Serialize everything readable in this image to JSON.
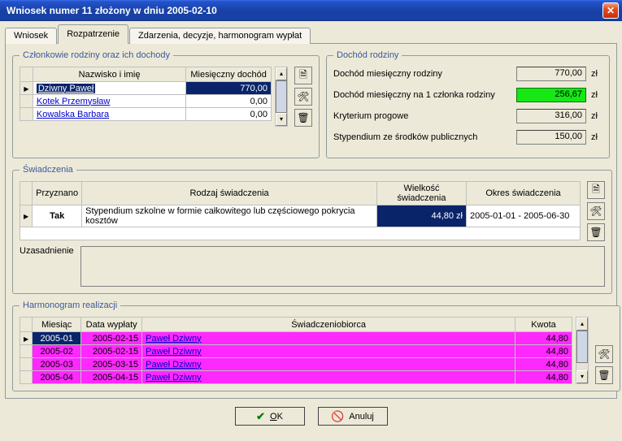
{
  "window": {
    "title": "Wniosek numer 11 złożony w dniu 2005-02-10"
  },
  "tabs": {
    "t0": "Wniosek",
    "t1": "Rozpatrzenie",
    "t2": "Zdarzenia, decyzje, harmonogram wypłat"
  },
  "family": {
    "legend": "Członkowie rodziny oraz ich dochody",
    "col_name": "Nazwisko i imię",
    "col_income": "Miesięczny dochód",
    "rows": [
      {
        "name": "Dziwny Paweł",
        "income": "770,00"
      },
      {
        "name": "Kotek Przemysław",
        "income": "0,00"
      },
      {
        "name": "Kowalska Barbara",
        "income": "0,00"
      }
    ]
  },
  "income": {
    "legend": "Dochód rodziny",
    "r0_label": "Dochód miesięczny rodziny",
    "r0_value": "770,00",
    "r1_label": "Dochód miesięczny na 1 członka rodziny",
    "r1_value": "256,67",
    "r2_label": "Kryterium progowe",
    "r2_value": "316,00",
    "r3_label": "Stypendium ze środków publicznych",
    "r3_value": "150,00",
    "unit": "zł"
  },
  "services": {
    "legend": "Świadczenia",
    "col_granted": "Przyznano",
    "col_kind": "Rodzaj świadczenia",
    "col_amount": "Wielkość świadczenia",
    "col_period": "Okres świadczenia",
    "row": {
      "granted": "Tak",
      "kind": "Stypendium szkolne w formie całkowitego lub częściowego pokrycia kosztów ",
      "amount": "44,80 zł",
      "period": "2005-01-01 - 2005-06-30"
    },
    "just_label": "Uzasadnienie",
    "just_text": ""
  },
  "schedule": {
    "legend": "Harmonogram realizacji",
    "col_month": "Miesiąc",
    "col_date": "Data wypłaty",
    "col_ben": "Świadczeniobiorca",
    "col_amt": "Kwota",
    "rows": [
      {
        "month": "2005-01",
        "date": "2005-02-15",
        "ben": "Paweł Dziwny",
        "amt": "44,80"
      },
      {
        "month": "2005-02",
        "date": "2005-02-15",
        "ben": "Paweł Dziwny",
        "amt": "44,80"
      },
      {
        "month": "2005-03",
        "date": "2005-03-15",
        "ben": "Paweł Dziwny",
        "amt": "44,80"
      },
      {
        "month": "2005-04",
        "date": "2005-04-15",
        "ben": "Paweł Dziwny",
        "amt": "44,80"
      }
    ]
  },
  "buttons": {
    "ok_pre": "O",
    "ok_rest": "K",
    "cancel": "Anuluj"
  }
}
